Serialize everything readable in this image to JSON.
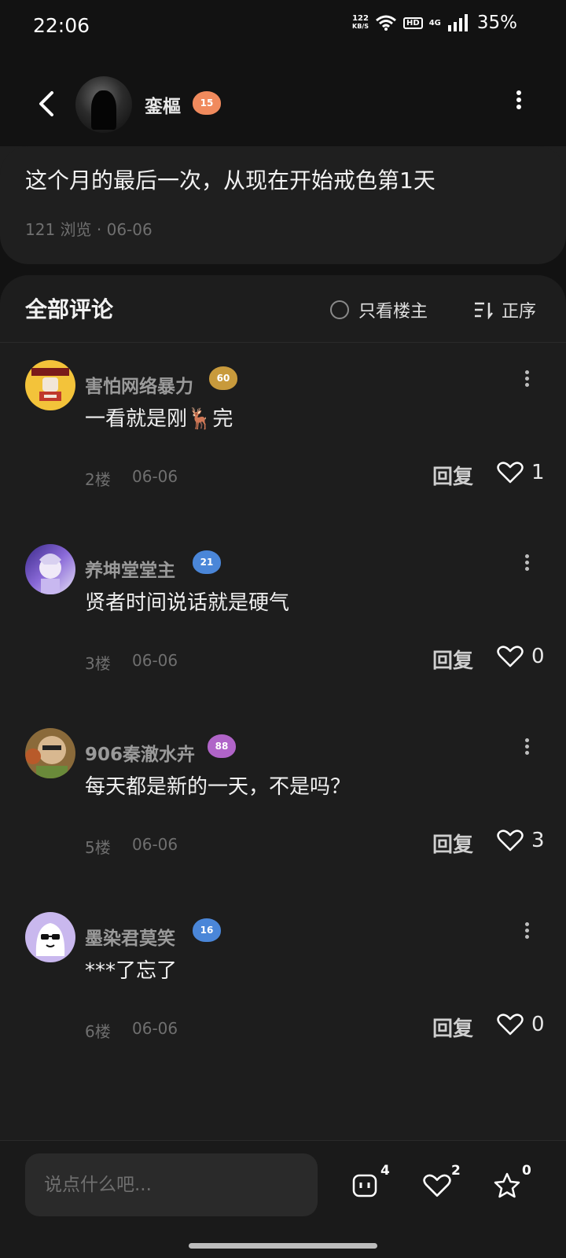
{
  "status_bar": {
    "time": "22:06",
    "net_speed_value": "122",
    "net_speed_unit": "KB/S",
    "hd_badge": "HD",
    "signal_type": "4G",
    "battery": "35%"
  },
  "header": {
    "author_name": "銮樞",
    "author_level": "15",
    "level_color": "#f08a5d"
  },
  "post": {
    "title": "这个月的最后一次，从现在开始戒色第1天",
    "meta": "121 浏览 · 06-06"
  },
  "comments_section": {
    "title": "全部评论",
    "only_owner_label": "只看楼主",
    "sort_label": "正序",
    "items": [
      {
        "user": "害怕网络暴力",
        "level": "60",
        "level_color": "#c89a3c",
        "text": "一看就是刚🦌完",
        "floor": "2楼",
        "date": "06-06",
        "reply_label": "回复",
        "likes": "1",
        "avatar_icon": "fist-avatar-icon"
      },
      {
        "user": "养坤堂堂主",
        "level": "21",
        "level_color": "#4a86d8",
        "text": "贤者时间说话就是硬气",
        "floor": "3楼",
        "date": "06-06",
        "reply_label": "回复",
        "likes": "0",
        "avatar_icon": "anime-avatar-icon"
      },
      {
        "user": "906秦澈水卉",
        "level": "88",
        "level_color": "#b064c8",
        "text": "每天都是新的一天，不是吗？",
        "floor": "5楼",
        "date": "06-06",
        "reply_label": "回复",
        "likes": "3",
        "avatar_icon": "face-avatar-icon"
      },
      {
        "user": "墨染君莫笑",
        "level": "16",
        "level_color": "#4a86d8",
        "text": "***了忘了",
        "floor": "6楼",
        "date": "06-06",
        "reply_label": "回复",
        "likes": "0",
        "avatar_icon": "sunglasses-avatar-icon"
      }
    ]
  },
  "bottom_bar": {
    "input_placeholder": "说点什么吧...",
    "comment_count": "4",
    "like_count": "2",
    "favorite_count": "0"
  }
}
